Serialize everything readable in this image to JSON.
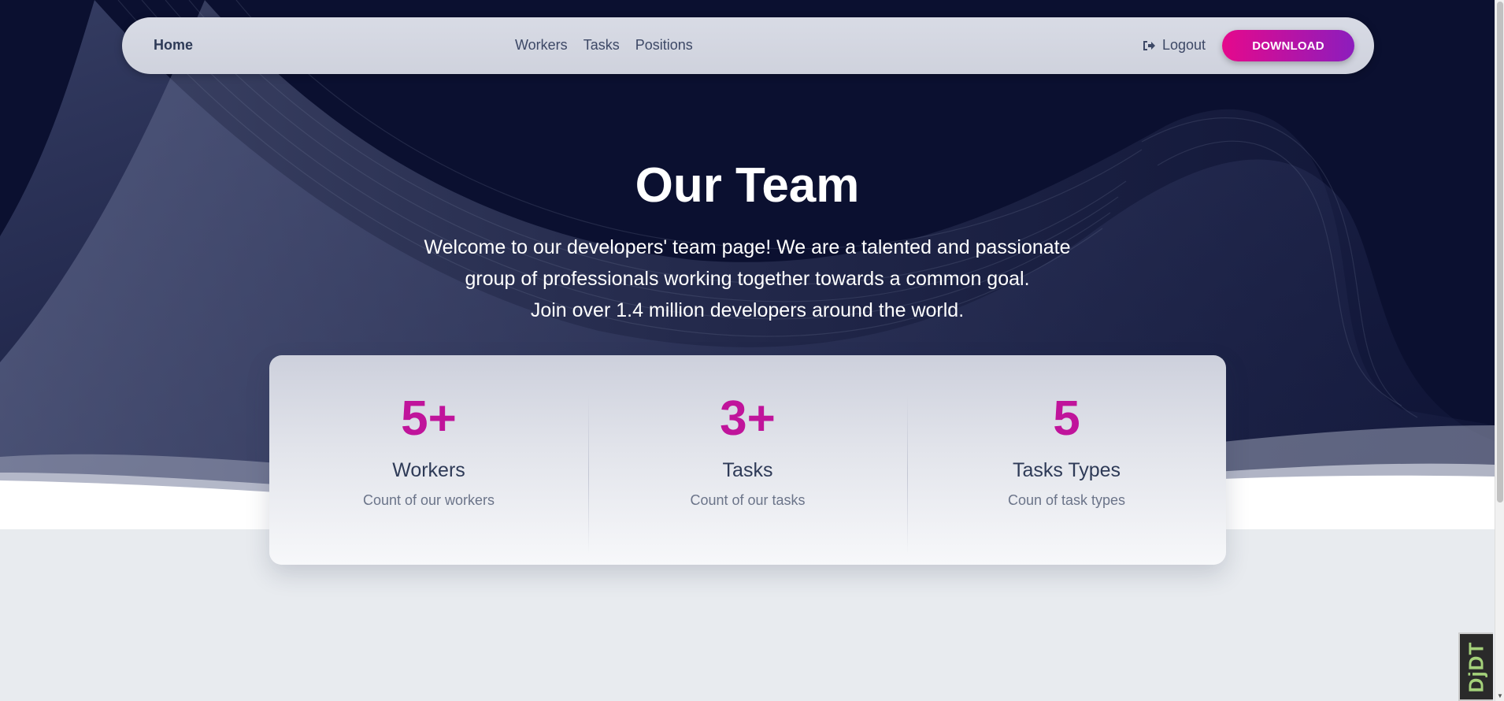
{
  "navbar": {
    "home_label": "Home",
    "links": [
      {
        "label": "Workers"
      },
      {
        "label": "Tasks"
      },
      {
        "label": "Positions"
      }
    ],
    "logout_label": "Logout",
    "download_label": "DOWNLOAD"
  },
  "hero": {
    "title": "Our Team",
    "text_line1": "Welcome to our developers' team page! We are a talented and passionate",
    "text_line2": "group of professionals working together towards a common goal.",
    "text_line3": "Join over 1.4 million developers around the world."
  },
  "stats": [
    {
      "value": "5+",
      "label": "Workers",
      "description": "Count of our workers"
    },
    {
      "value": "3+",
      "label": "Tasks",
      "description": "Count of our tasks"
    },
    {
      "value": "5",
      "label": "Tasks Types",
      "description": "Coun of task types"
    }
  ],
  "debug_toolbar": {
    "label": "DjDT"
  },
  "colors": {
    "accent": "#c0149b",
    "download_gradient_start": "#e5098c",
    "download_gradient_end": "#8c1dbd",
    "hero_background": "#0b1030"
  },
  "icons": {
    "logout": "sign-out-icon"
  }
}
